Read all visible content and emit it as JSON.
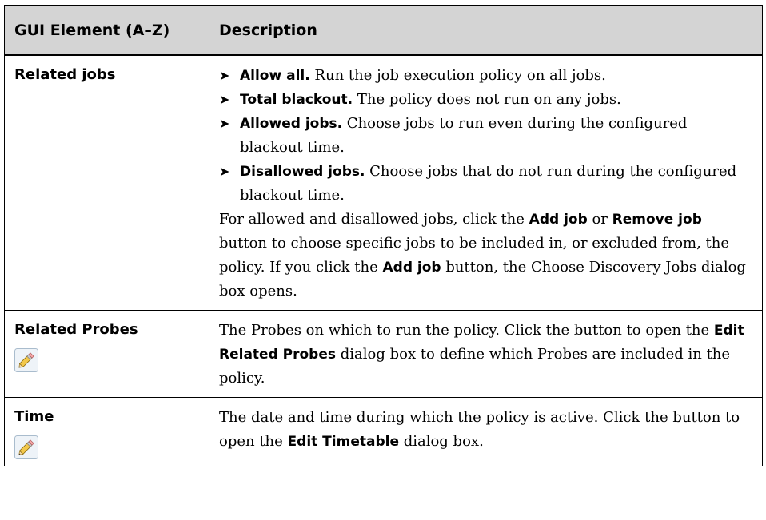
{
  "header": {
    "col1": "GUI Element (A–Z)",
    "col2": "Description"
  },
  "bullet_glyph": "➤",
  "rows": [
    {
      "element": "Related jobs",
      "bullets": [
        {
          "bold": "Allow all.",
          "text": " Run the job execution policy on all jobs."
        },
        {
          "bold": "Total blackout.",
          "text": " The policy does not run on any jobs."
        },
        {
          "bold": "Allowed jobs.",
          "text": " Choose jobs to run even during the configured blackout time."
        },
        {
          "bold": "Disallowed jobs.",
          "text": " Choose jobs that do not run during the configured blackout time."
        }
      ],
      "para": {
        "t1": "For allowed and disallowed jobs, click the ",
        "b1": "Add job",
        "t2": " or ",
        "b2": "Remove job",
        "t3": " button to choose specific jobs to be included in, or excluded from, the policy. If you click the ",
        "b3": "Add job",
        "t4": " button, the Choose Discovery Jobs dialog box opens."
      }
    },
    {
      "element": "Related Probes",
      "icon": "pencil-icon",
      "t1": "The Probes on which to run the policy. Click the button to open the ",
      "b1": "Edit Related Probes",
      "t2": " dialog box to define which Probes are included in the policy."
    },
    {
      "element": "Time",
      "icon": "pencil-icon",
      "t1": "The date and time during which the policy is active. Click the button to open the ",
      "b1": "Edit Timetable",
      "t2": " dialog box."
    }
  ]
}
